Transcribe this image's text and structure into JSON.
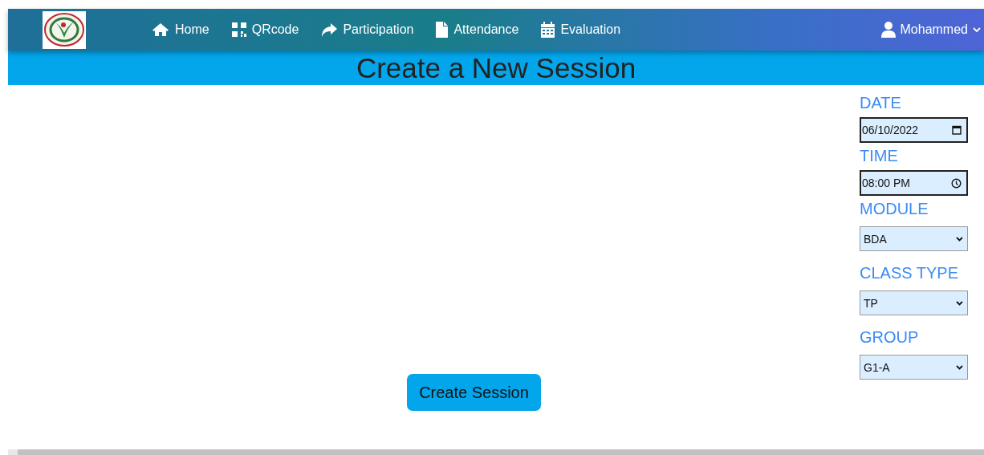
{
  "nav": {
    "items": [
      {
        "label": "Home"
      },
      {
        "label": "QRcode"
      },
      {
        "label": "Participation"
      },
      {
        "label": "Attendance"
      },
      {
        "label": "Evaluation"
      }
    ],
    "user": "Mohammed"
  },
  "title": "Create a New Session",
  "form": {
    "fields": [
      {
        "label": "DATE",
        "kind": "date",
        "value": "06/10/2022"
      },
      {
        "label": "TIME",
        "kind": "time",
        "value": "08:00 PM"
      },
      {
        "label": "MODULE",
        "kind": "select",
        "value": "BDA"
      },
      {
        "label": "CLASS TYPE",
        "kind": "select",
        "value": "TP"
      },
      {
        "label": "GROUP",
        "kind": "select",
        "value": "G1-A"
      }
    ]
  },
  "submit": "Create Session"
}
